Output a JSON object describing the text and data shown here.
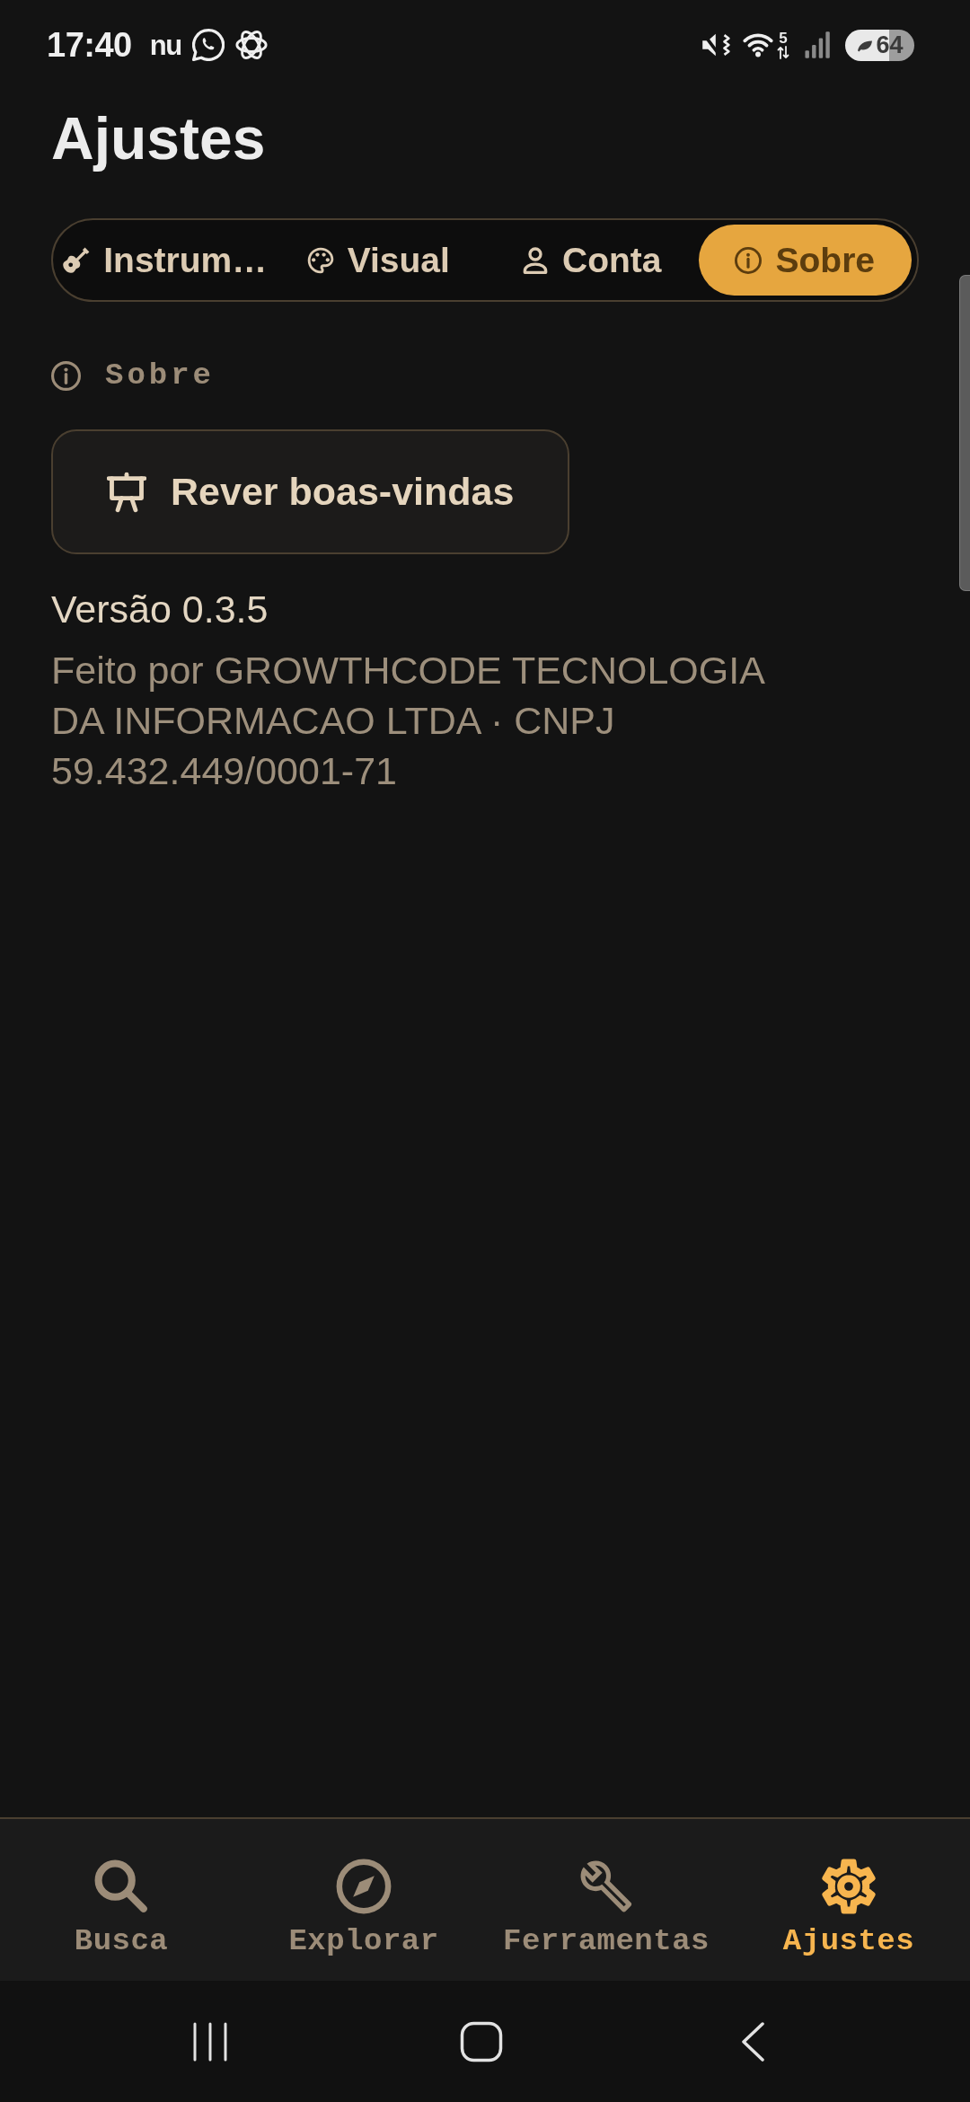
{
  "status_bar": {
    "time": "17:40",
    "app_logo": "nu",
    "wifi_band": "5",
    "battery": "64"
  },
  "title": "Ajustes",
  "tabs": [
    {
      "label": "Instrum…",
      "selected": false
    },
    {
      "label": "Visual",
      "selected": false
    },
    {
      "label": "Conta",
      "selected": false
    },
    {
      "label": "Sobre",
      "selected": true
    }
  ],
  "section": {
    "heading": "Sobre",
    "button": "Rever boas-vindas",
    "version": "Versão 0.3.5",
    "credits": "Feito por GROWTHCODE TECNOLOGIA DA INFORMACAO LTDA · CNPJ 59.432.449/0001-71"
  },
  "bottom_nav": [
    {
      "label": "Busca",
      "selected": false
    },
    {
      "label": "Explorar",
      "selected": false
    },
    {
      "label": "Ferramentas",
      "selected": false
    },
    {
      "label": "Ajustes",
      "selected": true
    }
  ]
}
